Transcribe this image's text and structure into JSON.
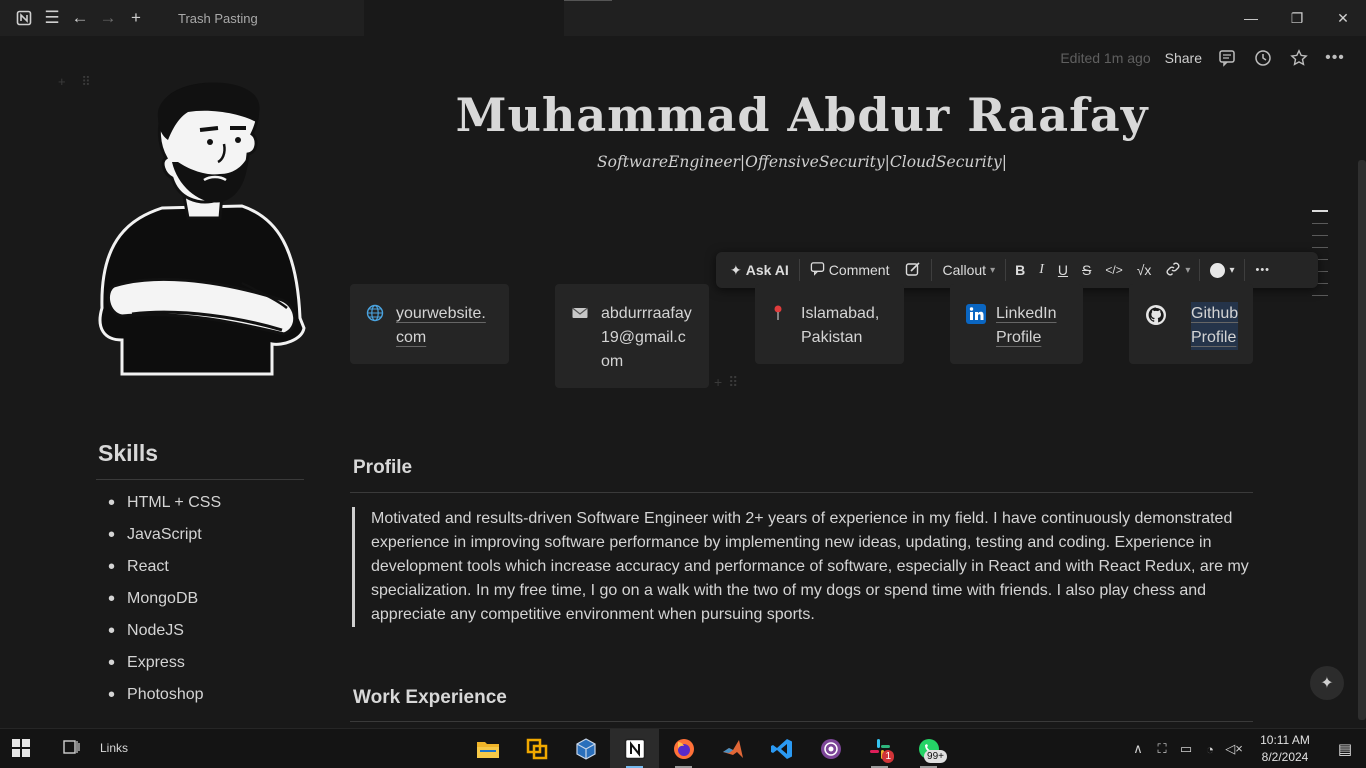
{
  "window": {
    "tab_title": "Trash Pasting",
    "minimize": "—",
    "maximize": "❐",
    "close": "✕"
  },
  "topbar": {
    "edited": "Edited 1m ago",
    "share": "Share"
  },
  "header": {
    "name": "Muhammad Abdur Raafay",
    "subtitle": "SoftwareEngineer|OffensiveSecurity|CloudSecurity|"
  },
  "format_toolbar": {
    "ask_ai": "Ask AI",
    "comment": "Comment",
    "block_type": "Callout",
    "bold": "B",
    "italic": "I",
    "underline": "U",
    "strike": "S",
    "code": "</>",
    "math": "√x",
    "more": "•••"
  },
  "contacts": [
    {
      "icon": "globe-icon",
      "text": "yourwebsite.\ncom"
    },
    {
      "icon": "mail-icon",
      "text": "abdurrraafay\n19@gmail.c\nom"
    },
    {
      "icon": "pin-icon",
      "text": "Islamabad,\nPakistan"
    },
    {
      "icon": "linkedin-icon",
      "text": "LinkedIn\nProfile"
    },
    {
      "icon": "github-icon",
      "text": "Github\nProfile"
    }
  ],
  "skills": {
    "heading": "Skills",
    "items": [
      "HTML + CSS",
      "JavaScript",
      "React",
      "MongoDB",
      "NodeJS",
      "Express",
      "Photoshop"
    ]
  },
  "profile": {
    "heading": "Profile",
    "text": "Motivated and results-driven Software Engineer with 2+ years of experience in my field. I have continuously demonstrated experience in improving software performance by implementing new ideas, updating, testing and coding. Experience in development tools which increase accuracy and performance of software, especially in React and with React Redux, are my specialization. In my free time, I go on a walk with the two of my dogs or spend time with friends. I also play chess and appreciate any competitive environment when pursuing sports."
  },
  "work": {
    "heading": "Work Experience"
  },
  "taskbar": {
    "links_label": "Links",
    "time": "10:11 AM",
    "date": "8/2/2024",
    "slack_badge": "1",
    "whatsapp_badge": "99+"
  }
}
